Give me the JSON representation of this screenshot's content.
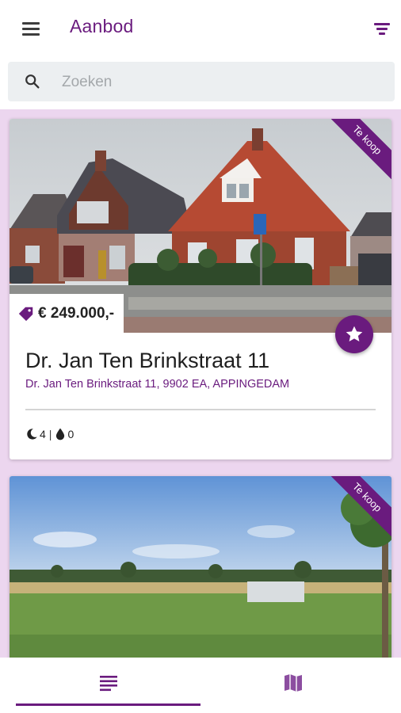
{
  "header": {
    "title": "Aanbod",
    "menu_icon": "menu-icon",
    "filter_icon": "filter-icon"
  },
  "search": {
    "placeholder": "Zoeken",
    "value": "",
    "icon": "search-icon"
  },
  "listings": [
    {
      "status": "Te koop",
      "price": "€ 249.000,-",
      "title": "Dr. Jan Ten Brinkstraat 11",
      "address": "Dr. Jan Ten Brinkstraat 11, 9902 EA, APPINGEDAM",
      "bedrooms": "4",
      "bathrooms": "0",
      "favorite_icon": "star-icon"
    },
    {
      "status": "Te koop"
    }
  ],
  "bottom_nav": {
    "tabs": [
      {
        "icon": "list-icon",
        "active": true
      },
      {
        "icon": "map-icon",
        "active": false
      }
    ]
  },
  "colors": {
    "primary": "#6a1b7e",
    "background": "#ecd6ef",
    "search_bg": "#eceff1"
  }
}
